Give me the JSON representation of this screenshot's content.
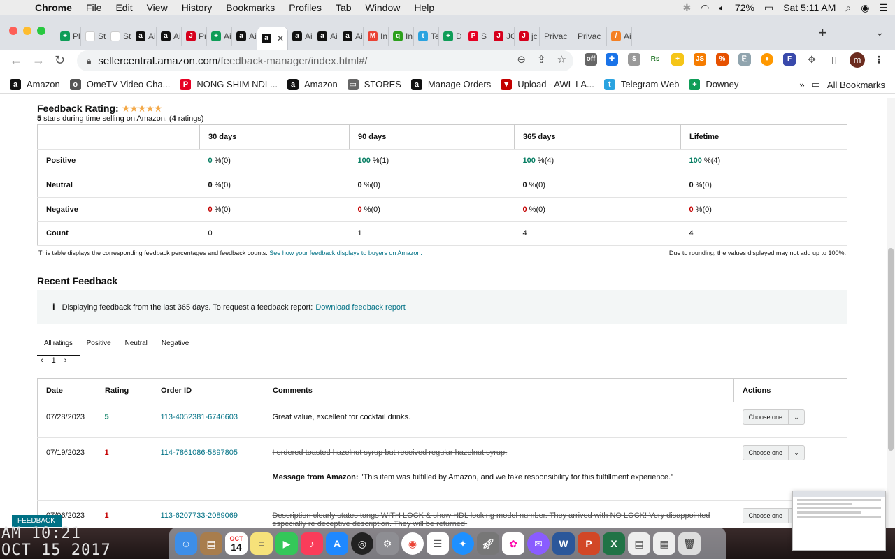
{
  "menubar": {
    "app": "Chrome",
    "items": [
      "File",
      "Edit",
      "View",
      "History",
      "Bookmarks",
      "Profiles",
      "Tab",
      "Window",
      "Help"
    ],
    "battery": "72%",
    "clock": "Sat 5:11 AM"
  },
  "tabs": [
    {
      "label": "Pl",
      "color": "#0f9d58",
      "glyph": "+"
    },
    {
      "label": "St",
      "color": "#ffffff",
      "glyph": ""
    },
    {
      "label": "St",
      "color": "#ffffff",
      "glyph": ""
    },
    {
      "label": "Ai",
      "color": "#111111",
      "glyph": "a"
    },
    {
      "label": "Ai",
      "color": "#111111",
      "glyph": "a"
    },
    {
      "label": "Pr",
      "color": "#d6001c",
      "glyph": "J"
    },
    {
      "label": "Ai",
      "color": "#0f9d58",
      "glyph": "+"
    },
    {
      "label": "Ai",
      "color": "#111111",
      "glyph": "a"
    },
    {
      "label": "",
      "color": "#111111",
      "glyph": "a",
      "active": true
    },
    {
      "label": "Ai",
      "color": "#111111",
      "glyph": "a"
    },
    {
      "label": "Ai",
      "color": "#111111",
      "glyph": "a"
    },
    {
      "label": "Ai",
      "color": "#111111",
      "glyph": "a"
    },
    {
      "label": "In",
      "color": "#ea4335",
      "glyph": "M"
    },
    {
      "label": "In",
      "color": "#2ca01c",
      "glyph": "q"
    },
    {
      "label": "Te",
      "color": "#2aa3e0",
      "glyph": "t"
    },
    {
      "label": "D",
      "color": "#0f9d58",
      "glyph": "+"
    },
    {
      "label": "S",
      "color": "#e60023",
      "glyph": "P"
    },
    {
      "label": "JC",
      "color": "#d6001c",
      "glyph": "J"
    },
    {
      "label": "jc",
      "color": "#d6001c",
      "glyph": "J"
    },
    {
      "label": "Privac",
      "color": "",
      "glyph": ""
    },
    {
      "label": "Privac",
      "color": "",
      "glyph": ""
    },
    {
      "label": "Ai",
      "color": "#f48024",
      "glyph": "/"
    }
  ],
  "address": {
    "host": "sellercentral.amazon.com",
    "path": "/feedback-manager/index.html#/"
  },
  "bookmarks": [
    {
      "label": "Amazon",
      "color": "#111111",
      "glyph": "a"
    },
    {
      "label": "OmeTV Video Cha...",
      "color": "#555555",
      "glyph": "o"
    },
    {
      "label": "NONG SHIM NDL...",
      "color": "#e60023",
      "glyph": "P"
    },
    {
      "label": "Amazon",
      "color": "#111111",
      "glyph": "a"
    },
    {
      "label": "STORES",
      "color": "#666666",
      "glyph": "▭"
    },
    {
      "label": "Manage Orders",
      "color": "#111111",
      "glyph": "a"
    },
    {
      "label": "Upload - AWL LA...",
      "color": "#c40000",
      "glyph": "▼"
    },
    {
      "label": "Telegram Web",
      "color": "#2aa3e0",
      "glyph": "t"
    },
    {
      "label": "Downey",
      "color": "#0f9d58",
      "glyph": "+"
    }
  ],
  "all_bookmarks": "All Bookmarks",
  "feedback": {
    "title": "Feedback Rating:",
    "stars": "★★★★★",
    "summary_count": "5",
    "summary_mid": " stars during time selling on Amazon. (",
    "summary_ratings": "4",
    "summary_end": " ratings)",
    "columns": [
      "30 days",
      "90 days",
      "365 days",
      "Lifetime"
    ],
    "rows": [
      {
        "label": "Positive",
        "cells": [
          [
            "0",
            " %(0)",
            "green"
          ],
          [
            "100",
            " %(1)",
            "green"
          ],
          [
            "100",
            " %(4)",
            "green"
          ],
          [
            "100",
            " %(4)",
            "green"
          ]
        ]
      },
      {
        "label": "Neutral",
        "cells": [
          [
            "0",
            " %(0)",
            ""
          ],
          [
            "0",
            " %(0)",
            ""
          ],
          [
            "0",
            " %(0)",
            ""
          ],
          [
            "0",
            " %(0)",
            ""
          ]
        ]
      },
      {
        "label": "Negative",
        "cells": [
          [
            "0",
            " %(0)",
            "red"
          ],
          [
            "0",
            " %(0)",
            "red"
          ],
          [
            "0",
            " %(0)",
            "red"
          ],
          [
            "0",
            " %(0)",
            "red"
          ]
        ]
      },
      {
        "label": "Count",
        "cells": [
          [
            "",
            "0",
            ""
          ],
          [
            "",
            "1",
            ""
          ],
          [
            "",
            "4",
            ""
          ],
          [
            "",
            "4",
            ""
          ]
        ]
      }
    ],
    "note": "This table displays the corresponding feedback percentages and feedback counts.",
    "note_link": "See how your feedback displays to buyers on Amazon.",
    "rounding_note": "Due to rounding, the values displayed may not add up to 100%."
  },
  "recent": {
    "title": "Recent Feedback",
    "info": "Displaying feedback from the last 365 days. To request a feedback report:",
    "info_link": "Download feedback report",
    "tabs": [
      "All ratings",
      "Positive",
      "Neutral",
      "Negative"
    ],
    "page": "1",
    "columns": [
      "Date",
      "Rating",
      "Order ID",
      "Comments",
      "Actions"
    ],
    "action_label": "Choose one",
    "rows": [
      {
        "date": "07/28/2023",
        "rating": "5",
        "rating_class": "green",
        "order": "113-4052381-6746603",
        "comment": "Great value, excellent for cocktail drinks.",
        "struck": false,
        "message_label": "",
        "message": ""
      },
      {
        "date": "07/19/2023",
        "rating": "1",
        "rating_class": "red",
        "order": "114-7861086-5897805",
        "comment": "I ordered toasted hazelnut syrup but received regular hazelnut syrup.",
        "struck": true,
        "message_label": "Message from Amazon:",
        "message": " \"This item was fulfilled by Amazon, and we take responsibility for this fulfillment experience.\""
      },
      {
        "date": "07/06/2023",
        "rating": "1",
        "rating_class": "red",
        "order": "113-6207733-2089069",
        "comment": "Description clearly states tongs WITH LOCK & show HDL locking model number. They arrived with NO LOCK! Very disappointed especially re deceptive description. They will be returned.",
        "struck": true,
        "message_label": "",
        "message": ""
      }
    ]
  },
  "feedback_badge": "FEEDBACK ✕",
  "desktop_clock": {
    "line1": "AM 10:21",
    "line2": "OCT 15 2017"
  },
  "dock_calendar": {
    "month": "OCT",
    "day": "14"
  }
}
